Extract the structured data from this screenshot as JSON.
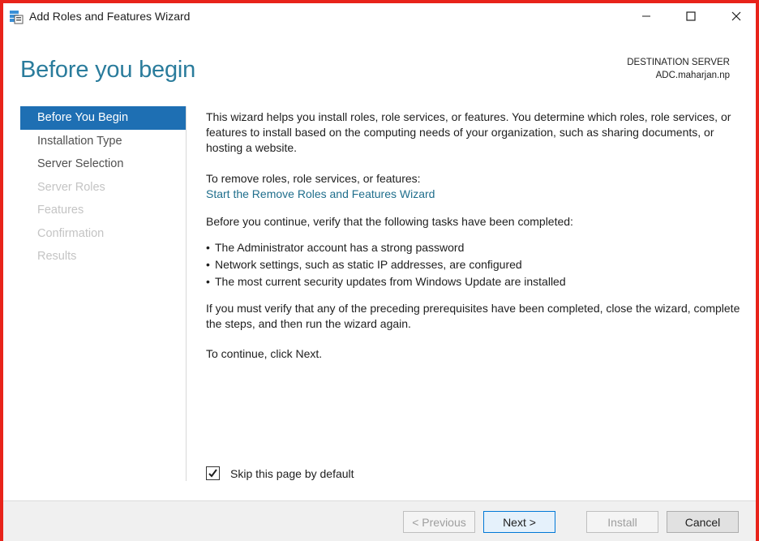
{
  "window": {
    "title": "Add Roles and Features Wizard"
  },
  "header": {
    "page_title": "Before you begin",
    "destination_label": "DESTINATION SERVER",
    "destination_server": "ADC.maharjan.np"
  },
  "nav": {
    "items": [
      {
        "label": "Before You Begin",
        "state": "active"
      },
      {
        "label": "Installation Type",
        "state": "enabled"
      },
      {
        "label": "Server Selection",
        "state": "enabled"
      },
      {
        "label": "Server Roles",
        "state": "disabled"
      },
      {
        "label": "Features",
        "state": "disabled"
      },
      {
        "label": "Confirmation",
        "state": "disabled"
      },
      {
        "label": "Results",
        "state": "disabled"
      }
    ]
  },
  "content": {
    "intro": "This wizard helps you install roles, role services, or features. You determine which roles, role services, or features to install based on the computing needs of your organization, such as sharing documents, or hosting a website.",
    "remove_label": "To remove roles, role services, or features:",
    "remove_link": "Start the Remove Roles and Features Wizard",
    "verify_intro": "Before you continue, verify that the following tasks have been completed:",
    "bullets": [
      "The Administrator account has a strong password",
      "Network settings, such as static IP addresses, are configured",
      "The most current security updates from Windows Update are installed"
    ],
    "verify_note": "If you must verify that any of the preceding prerequisites have been completed, close the wizard, complete the steps, and then run the wizard again.",
    "continue_note": "To continue, click Next."
  },
  "skip": {
    "label": "Skip this page by default",
    "checked": true
  },
  "footer": {
    "previous_label": "< Previous",
    "next_label": "Next >",
    "install_label": "Install",
    "cancel_label": "Cancel"
  },
  "colors": {
    "accent": "#1e6fb3",
    "title": "#2a7c9c",
    "link": "#1f6e8c",
    "frame_border": "#e8231a"
  }
}
